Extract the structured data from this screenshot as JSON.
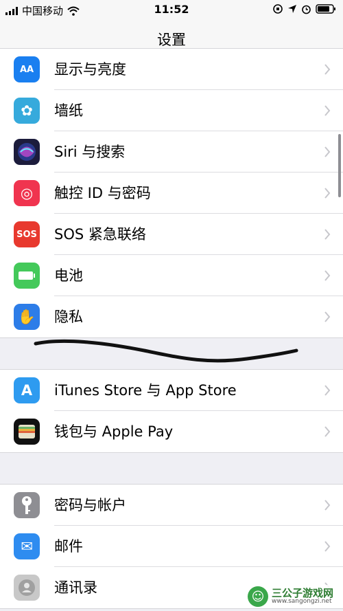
{
  "status": {
    "carrier": "中国移动",
    "time": "11:52"
  },
  "nav": {
    "title": "设置"
  },
  "group1": [
    {
      "label": "显示与亮度",
      "icon": "display-brightness-icon",
      "color": "#1a7ff0",
      "glyph": "AA"
    },
    {
      "label": "墙纸",
      "icon": "wallpaper-icon",
      "color": "#36aadc",
      "glyph": "✿"
    },
    {
      "label": "Siri 与搜索",
      "icon": "siri-icon",
      "color": "#1c1c3c",
      "glyph": ""
    },
    {
      "label": "触控 ID 与密码",
      "icon": "fingerprint-icon",
      "color": "#f0344f",
      "glyph": "◎"
    },
    {
      "label": "SOS 紧急联络",
      "icon": "sos-icon",
      "color": "#e8392e",
      "glyph": "SOS"
    },
    {
      "label": "电池",
      "icon": "battery-icon",
      "color": "#44c95a",
      "glyph": ""
    },
    {
      "label": "隐私",
      "icon": "privacy-hand-icon",
      "color": "#2d7de8",
      "glyph": "✋"
    }
  ],
  "group2": [
    {
      "label": "iTunes Store 与 App Store",
      "icon": "app-store-icon",
      "color": "#2e9bf0",
      "glyph": "A"
    },
    {
      "label": "钱包与 Apple Pay",
      "icon": "wallet-icon",
      "color": "#111111",
      "glyph": ""
    }
  ],
  "group3": [
    {
      "label": "密码与帐户",
      "icon": "key-icon",
      "color": "#8e8e93",
      "glyph": ""
    },
    {
      "label": "邮件",
      "icon": "mail-icon",
      "color": "#2e8cf0",
      "glyph": "✉"
    },
    {
      "label": "通讯录",
      "icon": "contacts-icon",
      "color": "#c8c8c8",
      "glyph": ""
    }
  ],
  "watermark": {
    "name": "三公子游戏网",
    "url": "www.sangongzi.net"
  }
}
